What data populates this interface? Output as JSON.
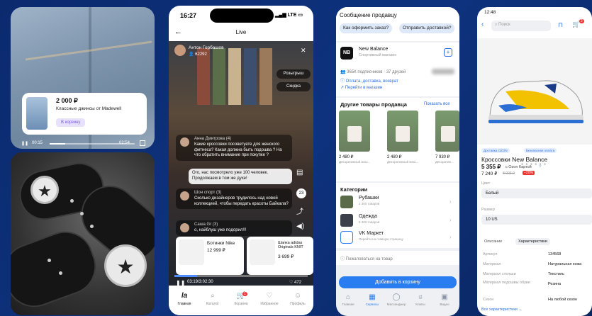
{
  "panel1": {
    "price": "2 000 ₽",
    "product_name": "Классные джинсы от Madewell",
    "cart_button": "В корзину",
    "time_current": "00:15",
    "time_total": "02:54",
    "progress": 0.18
  },
  "panel2": {
    "status_time": "16:27",
    "status_right": "LTE",
    "header_title": "Live",
    "host_name": "Антон Горбашов",
    "host_count": "62292",
    "pill_giveaway": "Розыгрыш",
    "pill_discount": "Скидка",
    "comments": [
      {
        "name": "Анна Дмитрова (4)",
        "text": "Какие кроссовки посоветуете для женского фитнеса? Какая должна быть подошва ? На что обратить внимание при покупке ?"
      },
      {
        "name": "",
        "text": "Ого, нас посмотрело уже 100 человек. Продолжаем в том же духе!"
      },
      {
        "name": "Шон спорт (3)",
        "text": "Сколько дизайнеров трудилось над новой коллекцией, чтобы передать красоты Байкала?"
      },
      {
        "name": "Саша Gr (3)",
        "text": "о, найблуш уже подорил!!!"
      }
    ],
    "side_count": "23",
    "products": [
      {
        "name": "Ботинки Nike",
        "price": "12 999 ₽"
      },
      {
        "name": "Шапка adidas Originals KNIT",
        "price": "3 699 ₽"
      }
    ],
    "play_time": "03:19/3:02:30",
    "likes": "472",
    "scrub_progress": 0.17,
    "tabs": [
      "Главная",
      "Каталог",
      "Корзина",
      "Избранное",
      "Профиль"
    ],
    "tab_logo": "la",
    "badge": "1"
  },
  "panel3": {
    "title": "Сообщение продавцу",
    "chip1": "Как оформить заказ?",
    "chip2": "Отправить доставкой?",
    "brand": "New Balance",
    "brand_sub": "Спортивный магазин",
    "followers": "365К подписчиков · 37 друзей",
    "payment": "Оплата, доставка, возврат",
    "go_shop": "Перейти в магазин",
    "other_title": "Другие товары продавца",
    "show_all": "Показать все",
    "items": [
      {
        "price": "2 480 ₽",
        "desc": "Декоративный меш..."
      },
      {
        "price": "2 480 ₽",
        "desc": "Декоративный меш..."
      },
      {
        "price": "7 930 ₽",
        "desc": "Декоратив..."
      }
    ],
    "cat_title": "Категории",
    "cats": [
      {
        "name": "Рубашки",
        "sub": "2 300 товаров"
      },
      {
        "name": "Одежда",
        "sub": "5 300 товаров"
      },
      {
        "name": "VK Маркет",
        "sub": "Перейти на главную страницу"
      }
    ],
    "complain": "Пожаловаться на товар",
    "add_cart": "Добавить в корзину",
    "nav": [
      "Главная",
      "Сервисы",
      "Мессенджер",
      "Клипы",
      "Видео"
    ]
  },
  "panel4": {
    "status_time": "12:48",
    "search": "Поиск",
    "cart_badge": "2",
    "tag1": "Доставка OZON",
    "tag2": "Безопасная оплата",
    "title": "Кроссовки New Balance",
    "price": "5 355 ₽",
    "price_note": "с Ozon Картой",
    "old_price": "7 240 ₽",
    "strike": "8 903 ₽",
    "discount": "−20%",
    "color_label": "Цвет",
    "color": "Белый",
    "size_label": "Размер",
    "size": "10 US",
    "tab_desc": "Описание",
    "tab_char": "Характеристики",
    "specs": [
      {
        "k": "Артикул",
        "v": "134568"
      },
      {
        "k": "Материал",
        "v": "Натуральная кожа"
      },
      {
        "k": "Материал стельки",
        "v": "Текстиль"
      },
      {
        "k": "Материал подошвы обуви",
        "v": "Резина"
      },
      {
        "k": "Сезон",
        "v": "На любой сезон"
      }
    ],
    "all_specs": "Все характеристики"
  }
}
